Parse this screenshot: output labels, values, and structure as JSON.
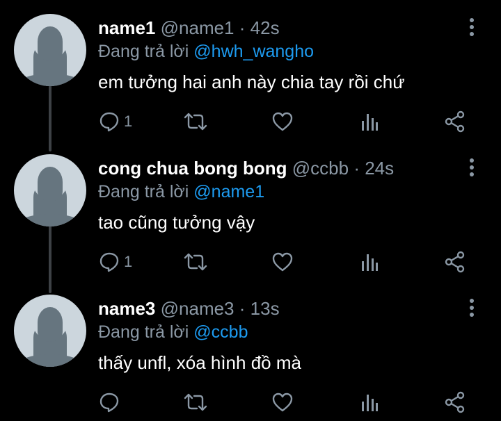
{
  "reply_prefix": "Đang trả lời",
  "colors": {
    "background": "#000000",
    "name": "#ffffff",
    "muted": "#8b98a5",
    "mention": "#1d9bf0",
    "avatar_bg": "#ccd6dd",
    "avatar_fg": "#66757f"
  },
  "icons": [
    "reply-icon",
    "retweet-icon",
    "like-icon",
    "analytics-icon",
    "share-icon",
    "more-icon"
  ],
  "tweets": [
    {
      "name": "name1",
      "handle": "@name1",
      "separator": "·",
      "time": "42s",
      "replying_to": "@hwh_wangho",
      "text": "em tưởng hai anh này chia tay rồi chứ",
      "reply_count": "1"
    },
    {
      "name": "cong chua bong bong",
      "handle": "@ccbb",
      "separator": "·",
      "time": "24s",
      "replying_to": "@name1",
      "text": "tao cũng tưởng vậy",
      "reply_count": "1"
    },
    {
      "name": "name3",
      "handle": "@name3",
      "separator": "·",
      "time": "13s",
      "replying_to": "@ccbb",
      "text": "thấy unfl, xóa hình đồ mà",
      "reply_count": ""
    }
  ]
}
